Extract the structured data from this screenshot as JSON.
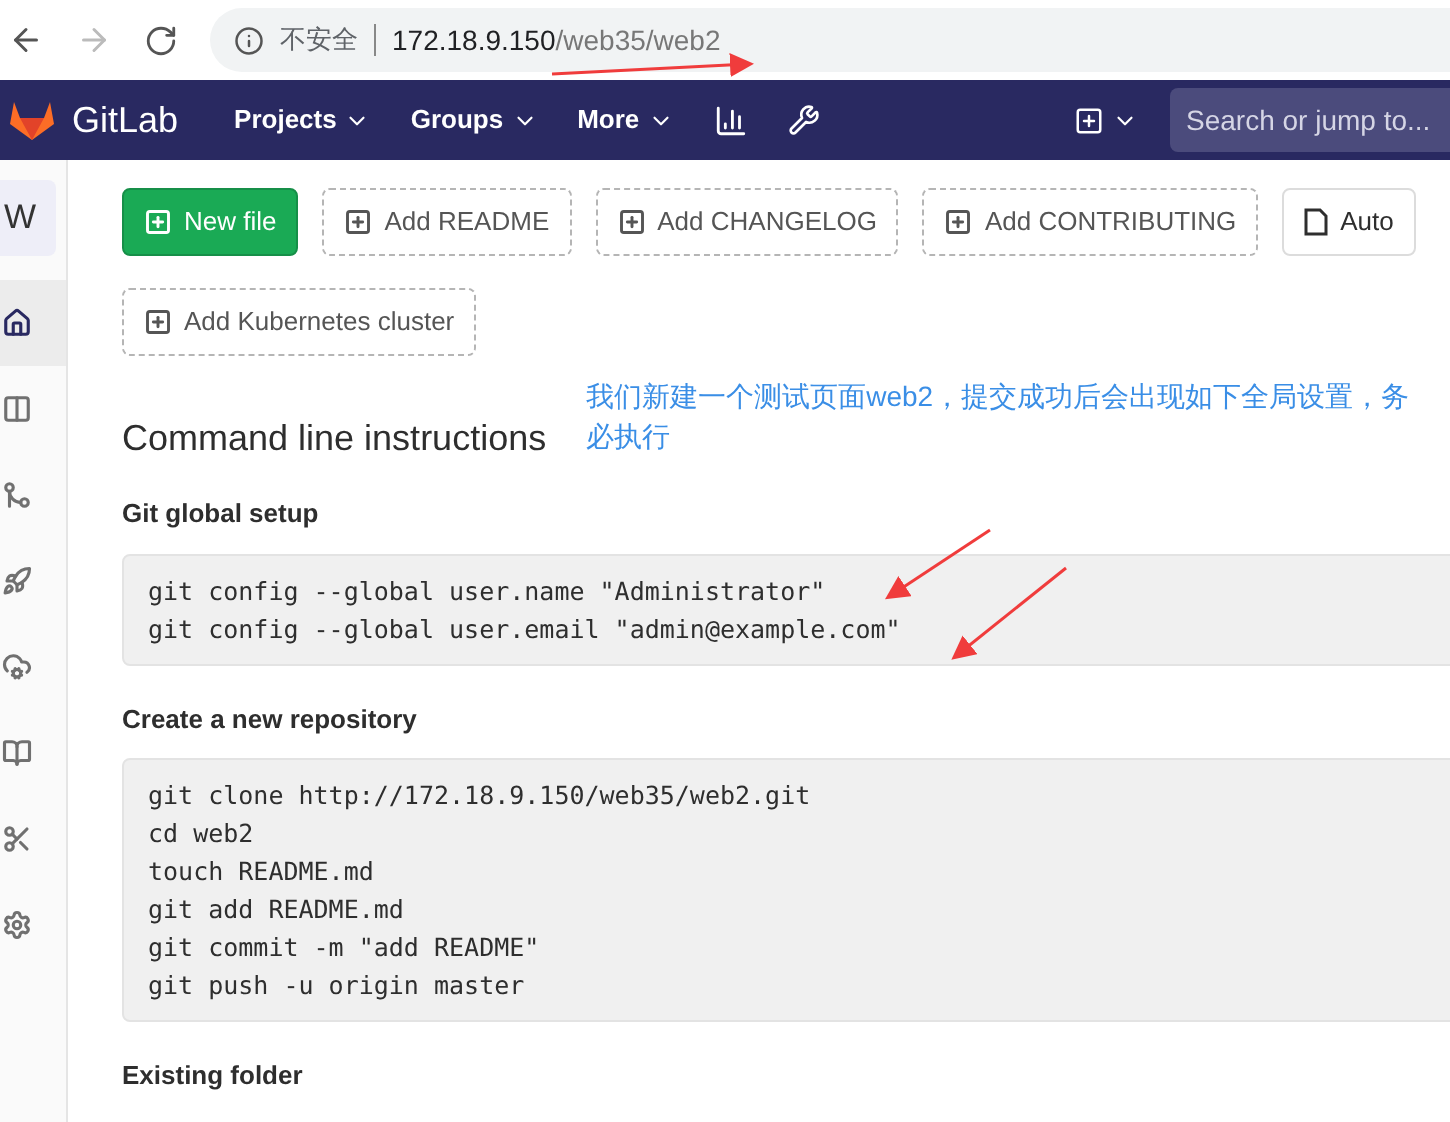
{
  "browser": {
    "security": "不安全",
    "host": "172.18.9.150",
    "path": "/web35/web2"
  },
  "navbar": {
    "brand": "GitLab",
    "menus": [
      {
        "label": "Projects"
      },
      {
        "label": "Groups"
      },
      {
        "label": "More"
      }
    ],
    "search": {
      "placeholder": "Search or jump to..."
    }
  },
  "sidebar": {
    "avatar": "W",
    "items": [
      {
        "kind": "home",
        "selected": true
      },
      {
        "kind": "issues",
        "selected": false
      },
      {
        "kind": "merge",
        "selected": false
      },
      {
        "kind": "rocket",
        "selected": false
      },
      {
        "kind": "cloud",
        "selected": false
      },
      {
        "kind": "wiki",
        "selected": false
      },
      {
        "kind": "snippets",
        "selected": false
      },
      {
        "kind": "settings",
        "selected": false
      }
    ]
  },
  "actions": [
    {
      "label": "New file",
      "kind": "primary"
    },
    {
      "label": "Add README",
      "kind": "dashed"
    },
    {
      "label": "Add CHANGELOG",
      "kind": "dashed"
    },
    {
      "label": "Add CONTRIBUTING",
      "kind": "dashed"
    },
    {
      "label": "Auto",
      "kind": "plain"
    },
    {
      "label": "Add Kubernetes cluster",
      "kind": "dashed"
    }
  ],
  "title": "Command line instructions",
  "annotation": "我们新建一个测试页面web2，提交成功后会出现如下全局设置，务必执行",
  "sections": [
    {
      "heading": "Git global setup",
      "lines": [
        "git config --global user.name \"Administrator\"",
        "git config --global user.email \"admin@example.com\""
      ]
    },
    {
      "heading": "Create a new repository",
      "lines": [
        "git clone http://172.18.9.150/web35/web2.git",
        "cd web2",
        "touch README.md",
        "git add README.md",
        "git commit -m \"add README\"",
        "git push -u origin master"
      ]
    },
    {
      "heading": "Existing folder"
    }
  ]
}
